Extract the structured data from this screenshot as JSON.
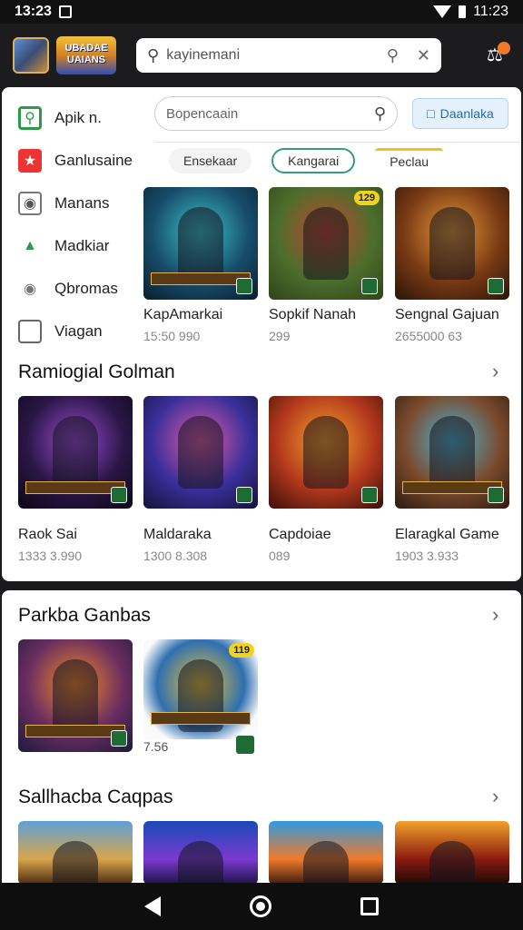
{
  "status": {
    "time_left": "13:23",
    "time_right": "11:23"
  },
  "header": {
    "logo_text": "UBADAE UAIANS",
    "search_placeholder": "kayinemani"
  },
  "sidebar": {
    "items": [
      {
        "label": "Apik n.",
        "icon": "apps-icon"
      },
      {
        "label": "Ganlusaine",
        "icon": "star-icon"
      },
      {
        "label": "Manans",
        "icon": "camera-icon"
      },
      {
        "label": "Madkiar",
        "icon": "tree-icon"
      },
      {
        "label": "Qbromas",
        "icon": "gamepad-icon"
      },
      {
        "label": "Viagan",
        "icon": "box-icon"
      }
    ]
  },
  "inner_search": {
    "placeholder": "Bopencaain"
  },
  "filter_button": {
    "label": "Daanlaka"
  },
  "chips": [
    "Ensekaar",
    "Kangarai",
    "Peclau"
  ],
  "top_row": [
    {
      "name": "KapAmarkai",
      "sub": "15:50 990",
      "tag": ""
    },
    {
      "name": "Sopkif Nanah",
      "sub": "299",
      "tag": "129"
    },
    {
      "name": "Sengnal Gajuan",
      "sub": "2655000 63",
      "tag": ""
    }
  ],
  "section1": {
    "title": "Ramiogial Golman",
    "items": [
      {
        "name": "Raok Sai",
        "sub": "1333 3.990"
      },
      {
        "name": "Maldaraka",
        "sub": "1300 8.308"
      },
      {
        "name": "Capdoiae",
        "sub": "089"
      },
      {
        "name": "Elaragkal Game",
        "sub": "1903 3.933"
      }
    ]
  },
  "section2": {
    "title": "Parkba Ganbas",
    "items": [
      {
        "sub": "",
        "tag": ""
      },
      {
        "sub": "7.56",
        "tag": "119"
      }
    ]
  },
  "section3": {
    "title": "Sallhacba Caqpas"
  },
  "colors": {
    "accent_green": "#3a9a80",
    "notif_orange": "#f07a23",
    "tag_yellow": "#f2d31c"
  }
}
